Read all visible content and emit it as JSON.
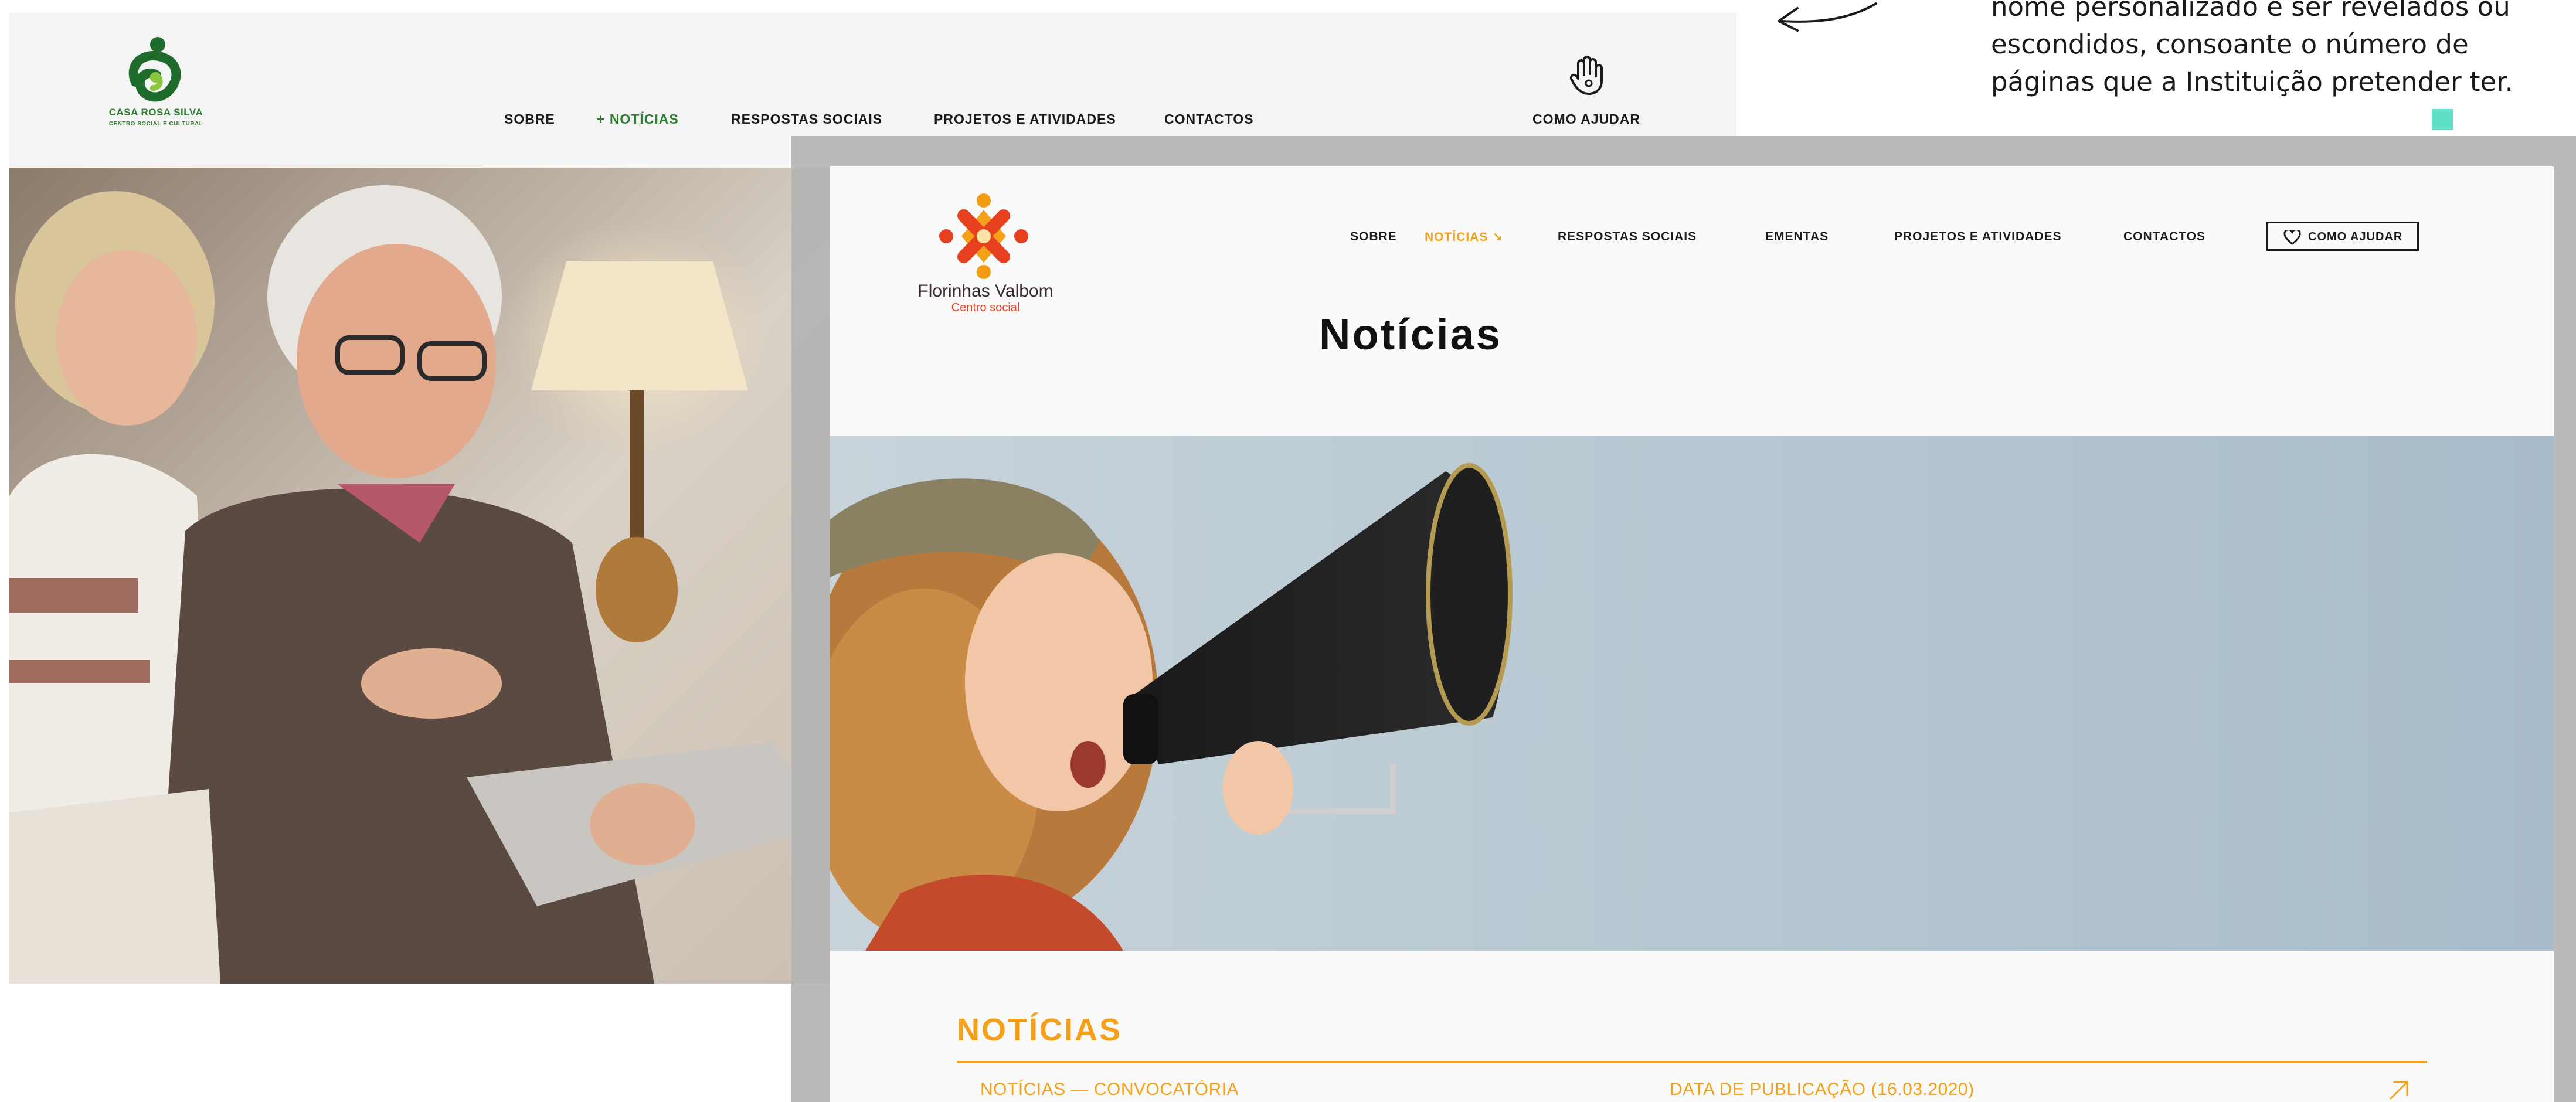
{
  "annotation": {
    "lines": [
      "nome personalizado e ser revelados ou",
      "escondidos, consoante o número de",
      "páginas que a Instituição pretender ter."
    ]
  },
  "back_site": {
    "logo": {
      "name": "CASA ROSA SILVA",
      "subtitle": "CENTRO SOCIAL E CULTURAL"
    },
    "nav": [
      {
        "label": "SOBRE"
      },
      {
        "label": "+ NOTÍCIAS",
        "active": true
      },
      {
        "label": "RESPOSTAS SOCIAIS"
      },
      {
        "label": "PROJETOS E ATIVIDADES"
      },
      {
        "label": "CONTACTOS"
      }
    ],
    "help": {
      "label": "COMO AJUDAR",
      "icon": "hand-icon"
    },
    "accent_color": "#2e7d32"
  },
  "front_site": {
    "logo": {
      "name": "Florinhas Valbom",
      "subtitle": "Centro social"
    },
    "nav": [
      {
        "label": "SOBRE"
      },
      {
        "label": "NOTÍCIAS ↘",
        "active": true
      },
      {
        "label": "RESPOSTAS SOCIAIS"
      },
      {
        "label": "EMENTAS"
      },
      {
        "label": "PROJETOS E ATIVIDADES"
      },
      {
        "label": "CONTACTOS"
      }
    ],
    "help": {
      "label": "COMO AJUDAR",
      "icon": "heart-icon"
    },
    "page_title": "Notícias",
    "section_heading": "NOTÍCIAS",
    "news_items": [
      {
        "category": "NOTÍCIAS — CONVOCATÓRIA",
        "date": "DATA DE PUBLICAÇÃO (16.03.2020)",
        "icon": "arrow-up-right-icon"
      }
    ],
    "accent_color": "#f5a01a"
  }
}
